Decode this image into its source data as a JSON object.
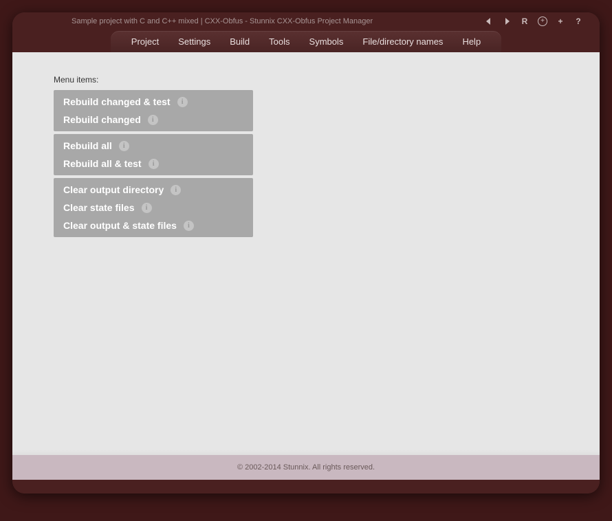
{
  "titlebar": {
    "title": "Sample project with C and C++ mixed | CXX-Obfus - Stunnix CXX-Obfus Project Manager"
  },
  "menubar": [
    "Project",
    "Settings",
    "Build",
    "Tools",
    "Symbols",
    "File/directory names",
    "Help"
  ],
  "content": {
    "heading": "Menu items:"
  },
  "groups": [
    {
      "items": [
        "Rebuild changed & test",
        "Rebuild changed"
      ]
    },
    {
      "items": [
        "Rebuild all",
        "Rebuild all & test"
      ]
    },
    {
      "items": [
        "Clear output directory",
        "Clear state files",
        "Clear output & state files"
      ]
    }
  ],
  "footer": "© 2002-2014 Stunnix. All rights reserved.",
  "toolbar_icons": {
    "back": "←",
    "forward": "→",
    "reload": "R",
    "zoom_plus_circled": "+",
    "zoom_plus": "+",
    "help": "?"
  }
}
